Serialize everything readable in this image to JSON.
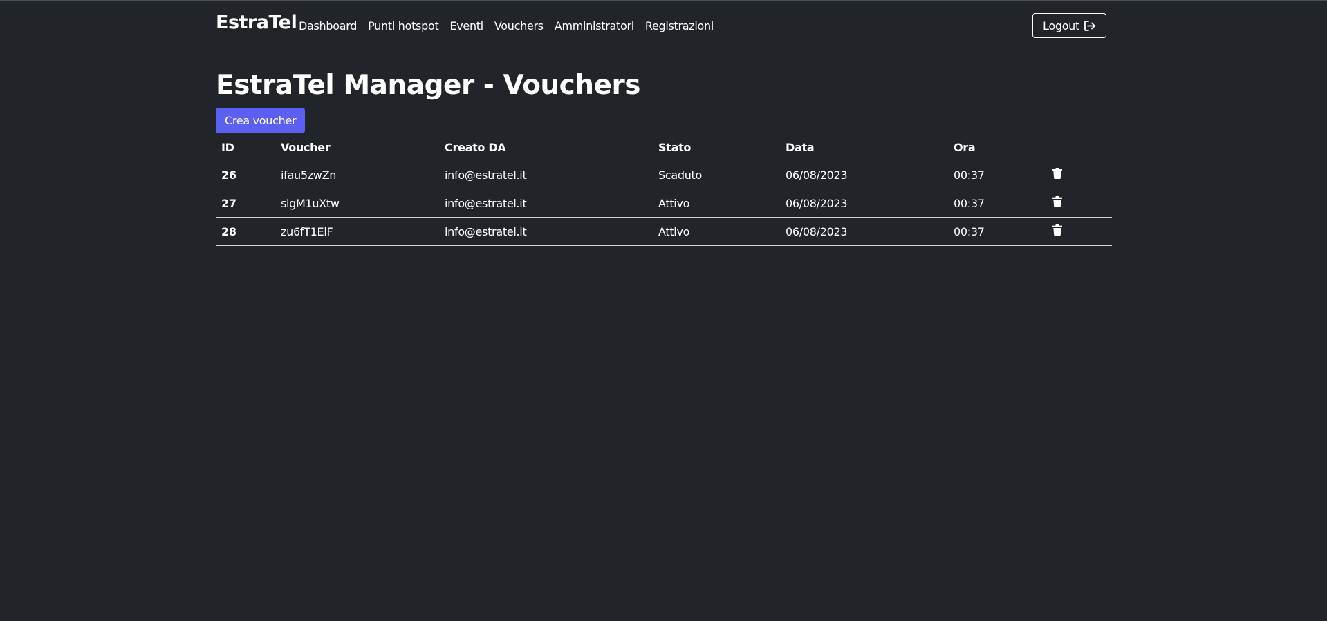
{
  "navbar": {
    "brand": "EstraTel",
    "links": [
      "Dashboard",
      "Punti hotspot",
      "Eventi",
      "Vouchers",
      "Amministratori",
      "Registrazioni"
    ],
    "logout_label": "Logout",
    "logout_icon": "sign-out-icon"
  },
  "page": {
    "title": "EstraTel Manager - Vouchers",
    "create_button": "Crea voucher",
    "accent_color": "#5b5ff2",
    "background_color": "#212529"
  },
  "table": {
    "headers": [
      "ID",
      "Voucher",
      "Creato DA",
      "Stato",
      "Data",
      "Ora"
    ],
    "rows": [
      {
        "id": "26",
        "voucher": "ifau5zwZn",
        "creato_da": "info@estratel.it",
        "stato": "Scaduto",
        "data": "06/08/2023",
        "ora": "00:37"
      },
      {
        "id": "27",
        "voucher": "slgM1uXtw",
        "creato_da": "info@estratel.it",
        "stato": "Attivo",
        "data": "06/08/2023",
        "ora": "00:37"
      },
      {
        "id": "28",
        "voucher": "zu6fT1ElF",
        "creato_da": "info@estratel.it",
        "stato": "Attivo",
        "data": "06/08/2023",
        "ora": "00:37"
      }
    ],
    "row_action_icon": "trash-icon"
  }
}
